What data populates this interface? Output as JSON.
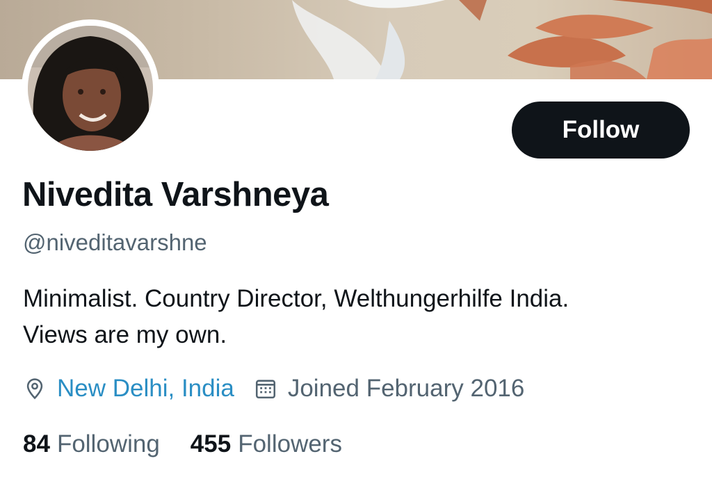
{
  "profile": {
    "name": "Nivedita Varshneya",
    "handle": "@niveditavarshne",
    "bio_line1": "Minimalist. Country Director, Welthungerhilfe India.",
    "bio_line2": "Views are my own.",
    "location": "New Delhi, India",
    "joined": "Joined February 2016"
  },
  "actions": {
    "follow_label": "Follow"
  },
  "stats": {
    "following_count": "84",
    "following_label": "Following",
    "followers_count": "455",
    "followers_label": "Followers"
  },
  "icons": {
    "location": "location-pin-icon",
    "calendar": "calendar-icon"
  },
  "colors": {
    "text_primary": "#0f1419",
    "text_secondary": "#536471",
    "link": "#2a8ec4",
    "button_bg": "#0f1419"
  }
}
